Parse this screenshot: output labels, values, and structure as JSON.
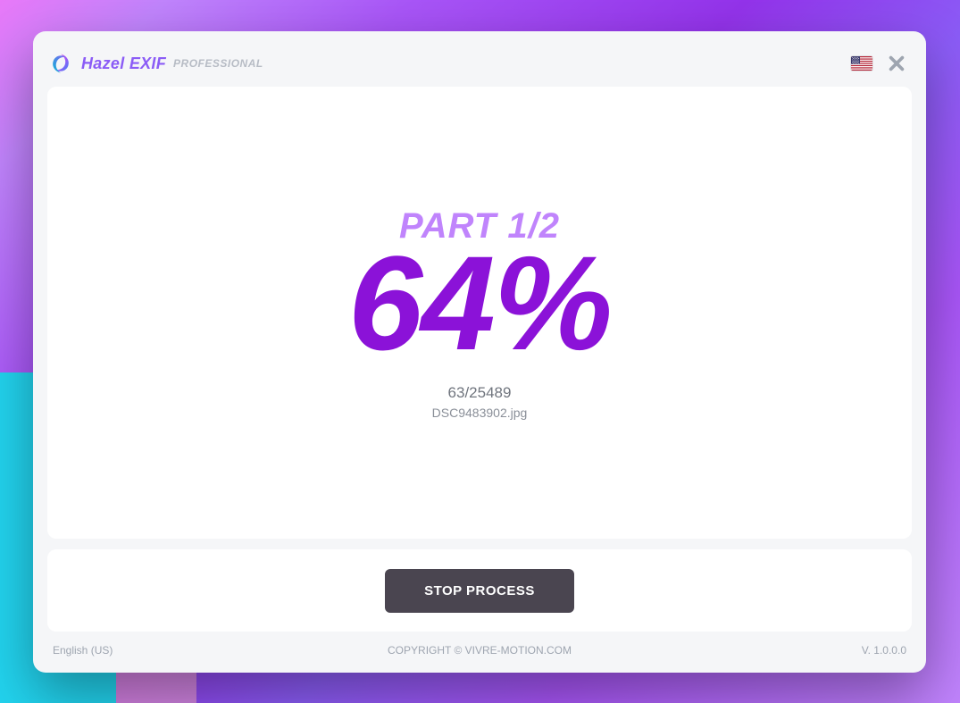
{
  "app": {
    "title": "Hazel EXIF",
    "edition": "PROFESSIONAL"
  },
  "progress": {
    "part_label": "PART 1/2",
    "percent_text": "64%",
    "percent_value": 64,
    "current": 63,
    "total": 25489,
    "counter_text": "63/25489",
    "filename": "DSC9483902.jpg"
  },
  "actions": {
    "stop_label": "STOP PROCESS"
  },
  "footer": {
    "language": "English (US)",
    "copyright": "COPYRIGHT © VIVRE-MOTION.COM",
    "version": "V. 1.0.0.0"
  },
  "icons": {
    "flag": "us-flag",
    "close": "close"
  }
}
